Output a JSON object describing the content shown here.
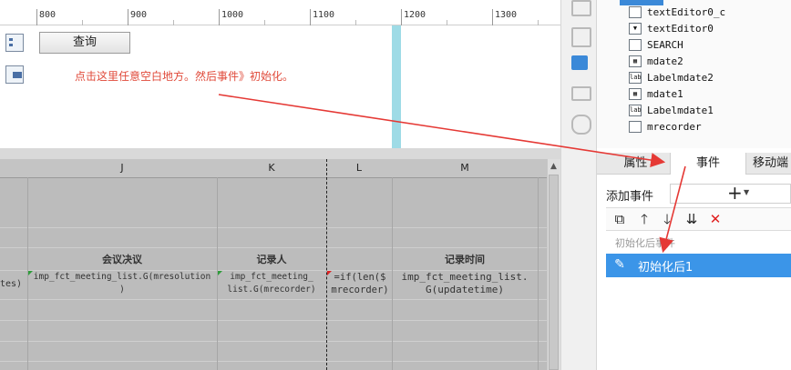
{
  "ruler": {
    "labels": [
      "800",
      "900",
      "1000",
      "1100",
      "1200",
      "1300"
    ]
  },
  "canvas": {
    "query_button": "查询",
    "instruction": "点击这里任意空白地方。然后事件》初始化。"
  },
  "sheet": {
    "columns": [
      "J",
      "K",
      "L",
      "M"
    ],
    "headers": [
      "会议决议",
      "记录人",
      "记录时间"
    ],
    "left_fragment": "tes)",
    "formula_j": "imp_fct_meeting_list.G(mresolution\n)",
    "formula_k": "imp_fct_meeting_\nlist.G(mrecorder)",
    "formula_l": "=if(len($\nmrecorder)",
    "formula_m": "imp_fct_meeting_list.\nG(updatetime)"
  },
  "tree": {
    "items": [
      "textEditor0_c",
      "textEditor0",
      "SEARCH",
      "mdate2",
      "Labelmdate2",
      "mdate1",
      "Labelmdate1",
      "mrecorder"
    ]
  },
  "tabs": {
    "properties": "属性",
    "events": "事件",
    "mobile": "移动端"
  },
  "events_panel": {
    "add_event_label": "添加事件",
    "add_symbol": "+",
    "hint": "初始化后事件",
    "event_item": "初始化后1"
  },
  "colors": {
    "accent": "#3b95e8",
    "instruction_text": "#e04a3a",
    "annotation_arrow": "#e53935"
  },
  "icons": {
    "toolbar": [
      "copy-icon",
      "arrow-up-icon",
      "arrow-down-icon",
      "sort-down-icon",
      "delete-icon"
    ],
    "event_item": "edit-icon"
  }
}
